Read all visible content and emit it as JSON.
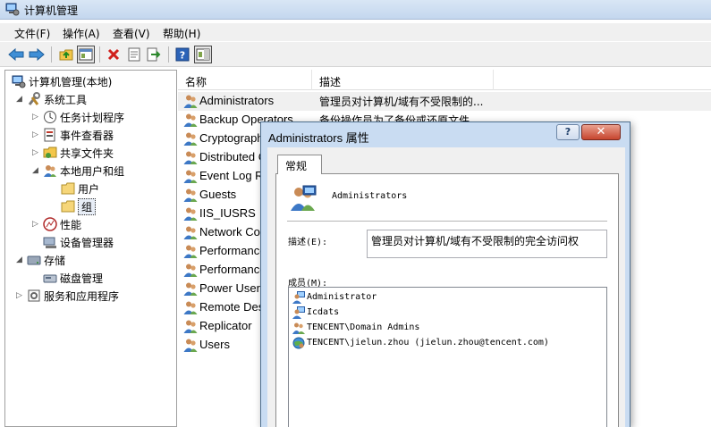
{
  "window": {
    "title": "计算机管理"
  },
  "menu": [
    "文件(F)",
    "操作(A)",
    "查看(V)",
    "帮助(H)"
  ],
  "toolbar": {
    "icons": [
      "back-icon",
      "forward-icon",
      "up-folder-icon",
      "show-tree-icon",
      "delete-icon",
      "properties-icon",
      "export-icon",
      "help-icon",
      "action-pane-icon"
    ]
  },
  "tree": {
    "root": "计算机管理(本地)",
    "system_tools": "系统工具",
    "task_scheduler": "任务计划程序",
    "event_viewer": "事件查看器",
    "shared_folders": "共享文件夹",
    "local_users_groups": "本地用户和组",
    "users": "用户",
    "groups": "组",
    "performance": "性能",
    "device_manager": "设备管理器",
    "storage": "存储",
    "disk_management": "磁盘管理",
    "services_apps": "服务和应用程序"
  },
  "list": {
    "columns": {
      "name": "名称",
      "description": "描述"
    },
    "rows": [
      {
        "name": "Administrators",
        "description": "管理员对计算机/域有不受限制的..."
      },
      {
        "name": "Backup Operators",
        "description": "备份操作员为了备份或还原文件..."
      },
      {
        "name": "Cryptographic Operators",
        "description": ""
      },
      {
        "name": "Distributed COM Users",
        "description": ""
      },
      {
        "name": "Event Log Readers",
        "description": ""
      },
      {
        "name": "Guests",
        "description": ""
      },
      {
        "name": "IIS_IUSRS",
        "description": ""
      },
      {
        "name": "Network Configuration Operators",
        "description": ""
      },
      {
        "name": "Performance Log Users",
        "description": ""
      },
      {
        "name": "Performance Monitor Users",
        "description": ""
      },
      {
        "name": "Power Users",
        "description": ""
      },
      {
        "name": "Remote Desktop Users",
        "description": ""
      },
      {
        "name": "Replicator",
        "description": ""
      },
      {
        "name": "Users",
        "description": ""
      }
    ]
  },
  "dialog": {
    "title": "Administrators 属性",
    "help_label": "?",
    "close_label": "✕",
    "tab": "常规",
    "group_name": "Administrators",
    "description_label": "描述(E):",
    "description_value": "管理员对计算机/域有不受限制的完全访问权",
    "members_label": "成员(M):",
    "members": [
      {
        "name": "Administrator",
        "icon": "user-icon"
      },
      {
        "name": "Icdats",
        "icon": "user-icon"
      },
      {
        "name": "TENCENT\\Domain Admins",
        "icon": "group-icon"
      },
      {
        "name": "TENCENT\\jielun.zhou (jielun.zhou@tencent.com)",
        "icon": "domain-user-icon"
      }
    ]
  }
}
